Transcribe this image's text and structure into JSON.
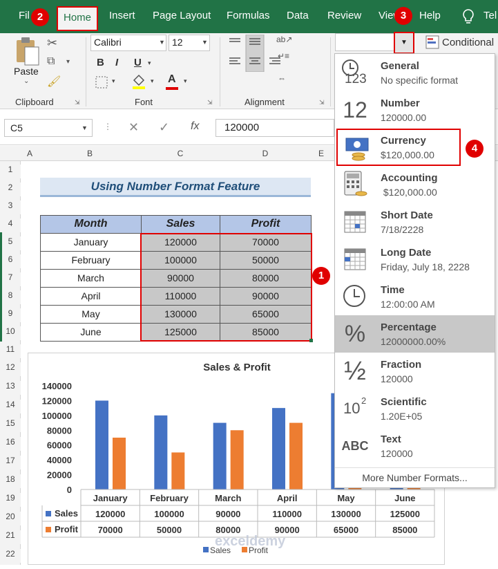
{
  "ribbon_tabs": {
    "file": "Fil",
    "home": "Home",
    "insert": "Insert",
    "page_layout": "Page Layout",
    "formulas": "Formulas",
    "data": "Data",
    "review": "Review",
    "view": "View",
    "help": "Help",
    "tell": "Tel"
  },
  "badges": {
    "b1": "1",
    "b2": "2",
    "b3": "3",
    "b4": "4"
  },
  "clipboard": {
    "paste": "Paste",
    "group": "Clipboard"
  },
  "font": {
    "name": "Calibri",
    "size": "12",
    "group": "Font",
    "bold": "B",
    "italic": "I",
    "underline": "U",
    "font_color_glyph": "A"
  },
  "alignment": {
    "group": "Alignment"
  },
  "number": {
    "format_value": "",
    "conditional": "Conditional"
  },
  "formula_bar": {
    "name_box": "C5",
    "fx": "fx",
    "value": "120000"
  },
  "columns": [
    "A",
    "B",
    "C",
    "D",
    "E"
  ],
  "rows": [
    "1",
    "2",
    "3",
    "4",
    "5",
    "6",
    "7",
    "8",
    "9",
    "10",
    "11",
    "12",
    "13",
    "14",
    "15",
    "16",
    "17",
    "18",
    "19",
    "20",
    "21",
    "22"
  ],
  "sheet": {
    "title": "Using Number Format Feature",
    "headers": [
      "Month",
      "Sales",
      "Profit"
    ],
    "data": [
      [
        "January",
        "120000",
        "70000"
      ],
      [
        "February",
        "100000",
        "50000"
      ],
      [
        "March",
        "90000",
        "80000"
      ],
      [
        "April",
        "110000",
        "90000"
      ],
      [
        "May",
        "130000",
        "65000"
      ],
      [
        "June",
        "125000",
        "85000"
      ]
    ]
  },
  "chart_data": {
    "type": "bar",
    "title": "Sales & Profit",
    "categories": [
      "January",
      "February",
      "March",
      "April",
      "May",
      "June"
    ],
    "series": [
      {
        "name": "Sales",
        "values": [
          120000,
          100000,
          90000,
          110000,
          130000,
          125000
        ],
        "color": "#4472c4"
      },
      {
        "name": "Profit",
        "values": [
          70000,
          50000,
          80000,
          90000,
          65000,
          85000
        ],
        "color": "#ed7d31"
      }
    ],
    "ylim": [
      0,
      140000
    ],
    "yticks": [
      "140000",
      "120000",
      "100000",
      "80000",
      "60000",
      "40000",
      "20000",
      "0"
    ],
    "legend_position": "bottom",
    "watermark": "exceldemy"
  },
  "dropdown": {
    "items": [
      {
        "name": "General",
        "example": "No specific format",
        "icon": "clock-123-icon"
      },
      {
        "name": "Number",
        "example": "120000.00",
        "icon": "number-12-icon"
      },
      {
        "name": "Currency",
        "example": "$120,000.00",
        "icon": "currency-icon"
      },
      {
        "name": "Accounting",
        "example": " $120,000.00",
        "icon": "calculator-icon"
      },
      {
        "name": "Short Date",
        "example": "7/18/2228",
        "icon": "calendar-icon"
      },
      {
        "name": "Long Date",
        "example": "Friday, July 18, 2228",
        "icon": "calendar-icon"
      },
      {
        "name": "Time",
        "example": "12:00:00 AM",
        "icon": "clock-icon"
      },
      {
        "name": "Percentage",
        "example": "12000000.00%",
        "icon": "percent-icon"
      },
      {
        "name": "Fraction",
        "example": "120000",
        "icon": "fraction-icon"
      },
      {
        "name": "Scientific",
        "example": "1.20E+05",
        "icon": "scientific-icon"
      },
      {
        "name": "Text",
        "example": "120000",
        "icon": "abc-icon"
      }
    ],
    "glyphs": {
      "number": "12",
      "percent": "%",
      "fraction": "½",
      "scientific_base": "10",
      "scientific_exp": "2",
      "text": "ABC",
      "general": "123"
    },
    "more": "More Number Formats...",
    "highlighted": "Percentage",
    "boxed": "Currency"
  },
  "colors": {
    "excel_green": "#217346",
    "annotation_red": "#e00000",
    "selection_gray": "#c8c8c8"
  }
}
